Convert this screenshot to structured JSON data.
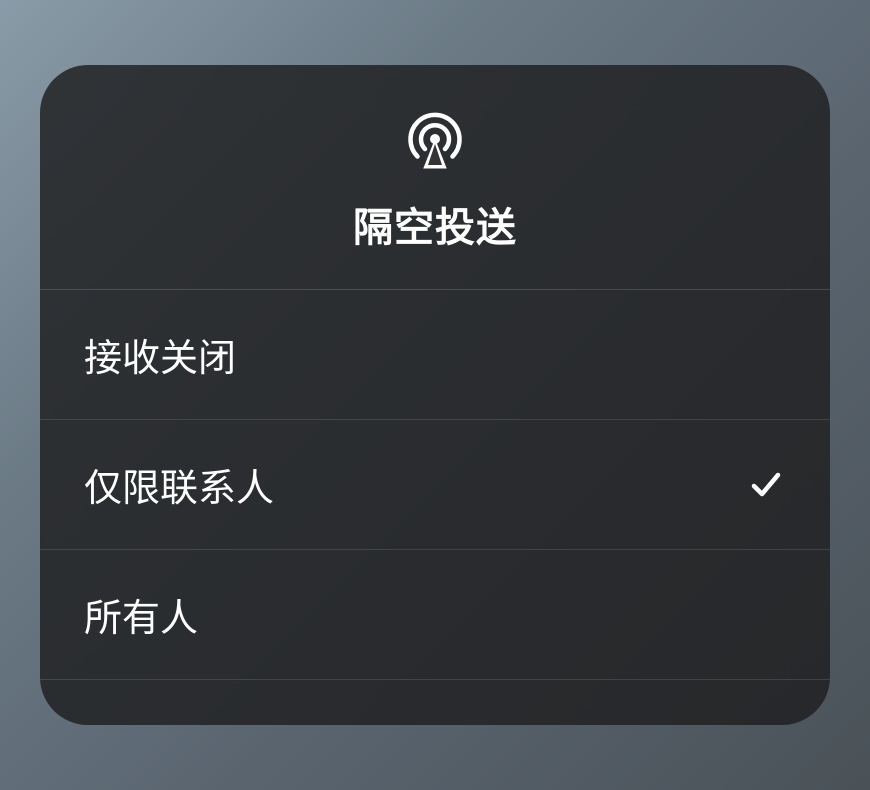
{
  "header": {
    "icon_name": "airdrop-icon",
    "title": "隔空投送"
  },
  "options": [
    {
      "label": "接收关闭",
      "selected": false
    },
    {
      "label": "仅限联系人",
      "selected": true
    },
    {
      "label": "所有人",
      "selected": false
    }
  ]
}
